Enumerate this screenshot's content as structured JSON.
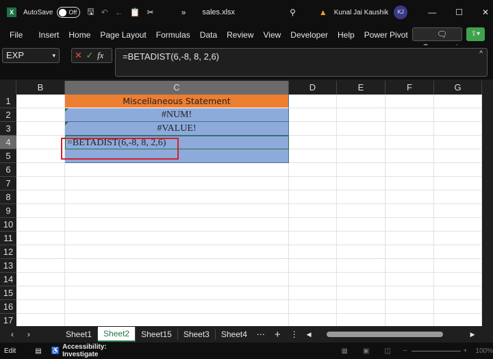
{
  "title": {
    "autosave": "AutoSave",
    "toggle": "Off",
    "more": "»",
    "filename": "sales.xlsx",
    "user": "Kunal Jai Kaushik",
    "initials": "KJ"
  },
  "ribbon": {
    "tabs": [
      "File",
      "Insert",
      "Home",
      "Page Layout",
      "Formulas",
      "Data",
      "Review",
      "View",
      "Developer",
      "Help",
      "Power Pivot"
    ],
    "comments": "Comments"
  },
  "formula_bar": {
    "name_box": "EXP",
    "fx": "fx",
    "formula": "=BETADIST(6,-8, 8, 2,6)"
  },
  "columns": [
    "B",
    "C",
    "D",
    "E",
    "F",
    "G"
  ],
  "rows": [
    "1",
    "2",
    "3",
    "4",
    "5",
    "6",
    "7",
    "8",
    "9",
    "10",
    "11",
    "12",
    "13",
    "14",
    "15",
    "16",
    "17"
  ],
  "cells": {
    "C1": "Miscellaneous Statement",
    "C2": "#NUM!",
    "C3": "#VALUE!",
    "C4": "=BETADIST(6,-8, 8, 2,6)"
  },
  "sheets": [
    "Sheet1",
    "Sheet2",
    "Sheet15",
    "Sheet3",
    "Sheet4"
  ],
  "active_sheet": "Sheet2",
  "status": {
    "mode": "Edit",
    "accessibility": "Accessibility: Investigate",
    "zoom": "100%"
  },
  "colors": {
    "header_fill": "#ed7d31",
    "data_fill": "#8eaadb",
    "highlight": "#d0202c"
  }
}
